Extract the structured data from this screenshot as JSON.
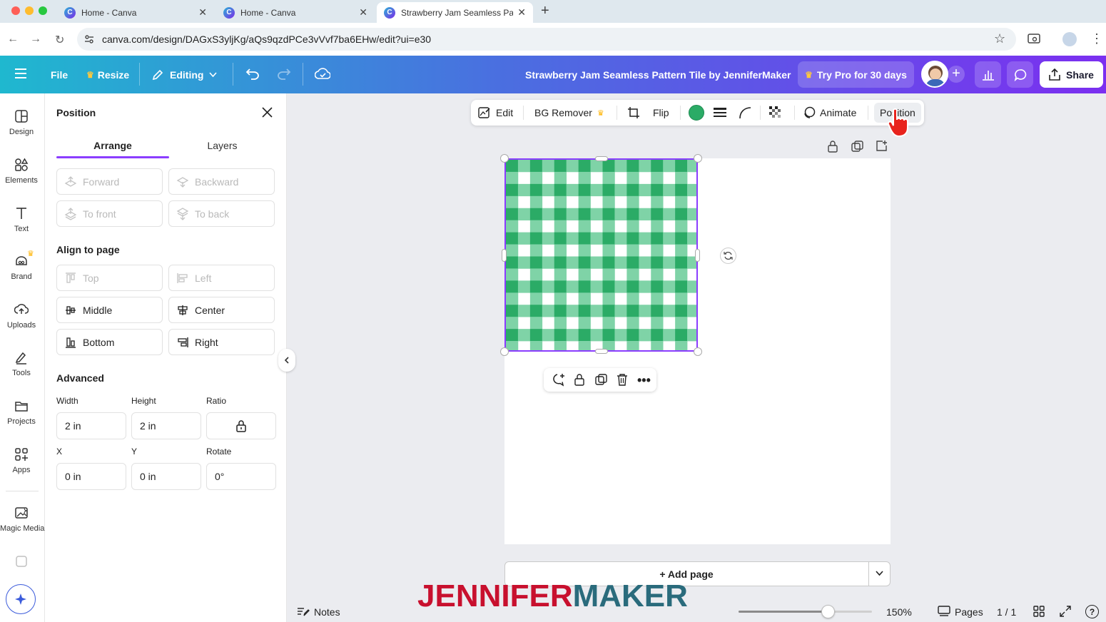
{
  "browser": {
    "tabs": [
      {
        "title": "Home - Canva",
        "active": false
      },
      {
        "title": "Home - Canva",
        "active": false
      },
      {
        "title": "Strawberry Jam Seamless Pa",
        "active": true
      }
    ],
    "url": "canva.com/design/DAGxS3yljKg/aQs9qzdPCe3vVvf7ba6EHw/edit?ui=e30"
  },
  "header": {
    "file_label": "File",
    "resize_label": "Resize",
    "editing_label": "Editing",
    "design_title": "Strawberry Jam Seamless Pattern Tile by JenniferMaker",
    "try_pro_label": "Try Pro for 30 days",
    "share_label": "Share"
  },
  "rail": {
    "items": [
      {
        "label": "Design",
        "icon": "design-icon"
      },
      {
        "label": "Elements",
        "icon": "elements-icon"
      },
      {
        "label": "Text",
        "icon": "text-icon"
      },
      {
        "label": "Brand",
        "icon": "brand-icon"
      },
      {
        "label": "Uploads",
        "icon": "uploads-icon"
      },
      {
        "label": "Tools",
        "icon": "tools-icon"
      },
      {
        "label": "Projects",
        "icon": "projects-icon"
      },
      {
        "label": "Apps",
        "icon": "apps-icon"
      },
      {
        "label": "Magic Media",
        "icon": "magic-media-icon"
      }
    ]
  },
  "panel": {
    "title": "Position",
    "tabs": {
      "arrange": "Arrange",
      "layers": "Layers"
    },
    "arrange": {
      "forward": "Forward",
      "backward": "Backward",
      "to_front": "To front",
      "to_back": "To back"
    },
    "align_heading": "Align to page",
    "align": {
      "top": "Top",
      "left": "Left",
      "middle": "Middle",
      "center": "Center",
      "bottom": "Bottom",
      "right": "Right"
    },
    "advanced_heading": "Advanced",
    "width_label": "Width",
    "height_label": "Height",
    "ratio_label": "Ratio",
    "width_value": "2 in",
    "height_value": "2 in",
    "x_label": "X",
    "y_label": "Y",
    "rotate_label": "Rotate",
    "x_value": "0 in",
    "y_value": "0 in",
    "rotate_value": "0°"
  },
  "toolbar": {
    "edit": "Edit",
    "bg_remover": "BG Remover",
    "flip": "Flip",
    "animate": "Animate",
    "position": "Position",
    "color": "#2bab66"
  },
  "canvas": {
    "pattern_colors": {
      "dark": "#2bab66",
      "light": "#7fd3a7",
      "white": "#ffffff"
    },
    "add_page_label": "+ Add page"
  },
  "footer": {
    "notes_label": "Notes",
    "zoom": "150%",
    "zoom_fraction": 0.67,
    "pages_label": "Pages",
    "page_count": "1 / 1"
  },
  "watermark": {
    "part1": "JENNIFER",
    "part2": "MAKER"
  },
  "colors": {
    "accent": "#8b3dff",
    "header_start": "#1fb8cf",
    "header_end": "#7b2ff0"
  }
}
